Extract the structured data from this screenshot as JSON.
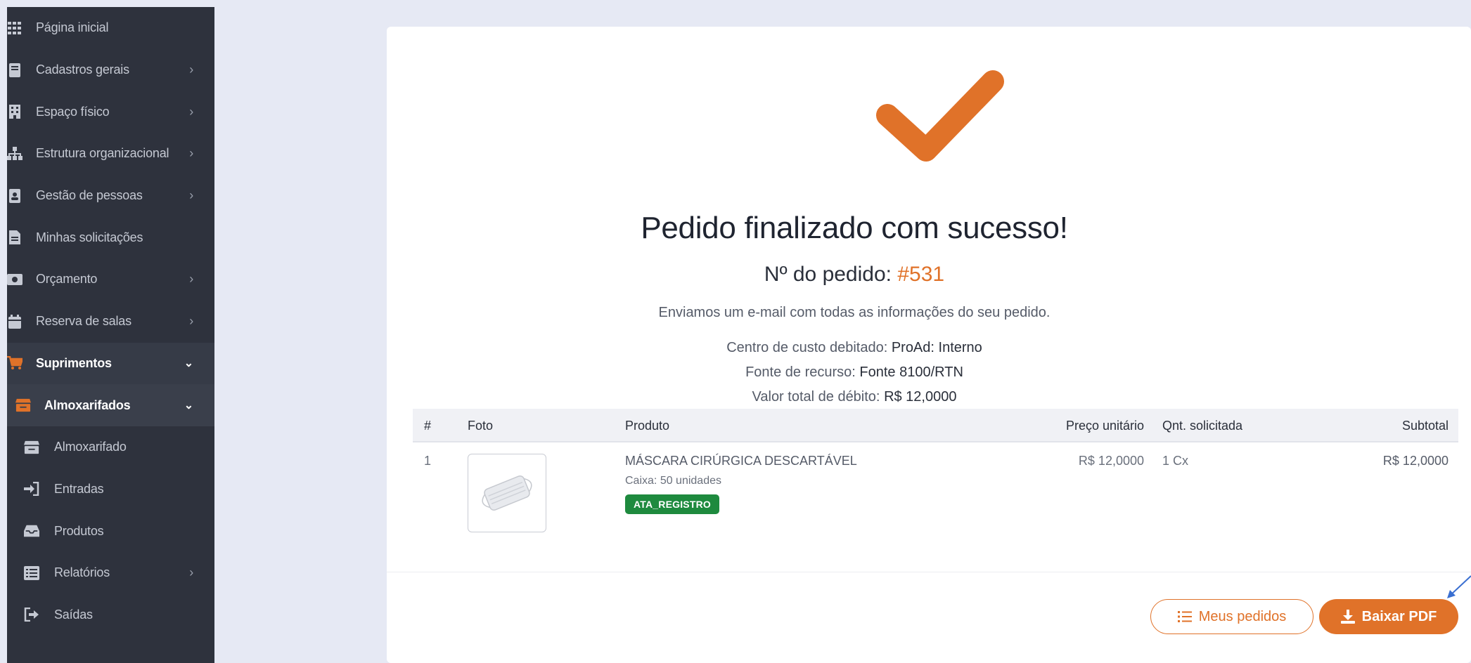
{
  "sidebar": {
    "items": [
      {
        "label": "Página inicial",
        "icon": "grid-icon",
        "chevron": ""
      },
      {
        "label": "Cadastros gerais",
        "icon": "book-icon",
        "chevron": "›"
      },
      {
        "label": "Espaço físico",
        "icon": "building-icon",
        "chevron": "›"
      },
      {
        "label": "Estrutura organizacional",
        "icon": "sitemap-icon",
        "chevron": "›"
      },
      {
        "label": "Gestão de pessoas",
        "icon": "address-book-icon",
        "chevron": "›"
      },
      {
        "label": "Minhas solicitações",
        "icon": "file-icon",
        "chevron": ""
      },
      {
        "label": "Orçamento",
        "icon": "money-icon",
        "chevron": "›"
      },
      {
        "label": "Reserva de salas",
        "icon": "calendar-icon",
        "chevron": "›"
      },
      {
        "label": "Suprimentos",
        "icon": "cart-icon",
        "chevron": "⌄"
      },
      {
        "label": "Almoxarifados",
        "icon": "warehouse-icon",
        "chevron": "⌄"
      },
      {
        "label": "Almoxarifado",
        "icon": "warehouse-icon",
        "chevron": ""
      },
      {
        "label": "Entradas",
        "icon": "sign-in-icon",
        "chevron": ""
      },
      {
        "label": "Produtos",
        "icon": "inbox-icon",
        "chevron": ""
      },
      {
        "label": "Relatórios",
        "icon": "list-icon",
        "chevron": "›"
      },
      {
        "label": "Saídas",
        "icon": "sign-out-icon",
        "chevron": ""
      }
    ]
  },
  "main": {
    "title": "Pedido finalizado com sucesso!",
    "order_label": "Nº do pedido:",
    "order_number": "#531",
    "email_message": "Enviamos um e-mail com todas as informações do seu pedido.",
    "cost_center_label": "Centro de custo debitado:",
    "cost_center_value": "ProAd: Interno",
    "resource_label": "Fonte de recurso:",
    "resource_value": "Fonte 8100/RTN",
    "total_label": "Valor total de débito:",
    "total_value": "R$ 12,0000"
  },
  "table": {
    "headers": {
      "num": "#",
      "photo": "Foto",
      "product": "Produto",
      "unit_price": "Preço unitário",
      "qty": "Qnt. solicitada",
      "subtotal": "Subtotal"
    },
    "rows": [
      {
        "num": "1",
        "product": "MÁSCARA CIRÚRGICA DESCARTÁVEL",
        "box_label": "Caixa:",
        "box_value": "50 unidades",
        "badge": "ATA_REGISTRO",
        "unit_price": "R$ 12,0000",
        "qty": "1 Cx",
        "subtotal": "R$ 12,0000"
      }
    ]
  },
  "actions": {
    "my_orders": "Meus pedidos",
    "download_pdf": "Baixar PDF"
  },
  "colors": {
    "accent": "#e07229",
    "sidebar_bg": "#2e323d",
    "badge_green": "#1e8a3e"
  }
}
